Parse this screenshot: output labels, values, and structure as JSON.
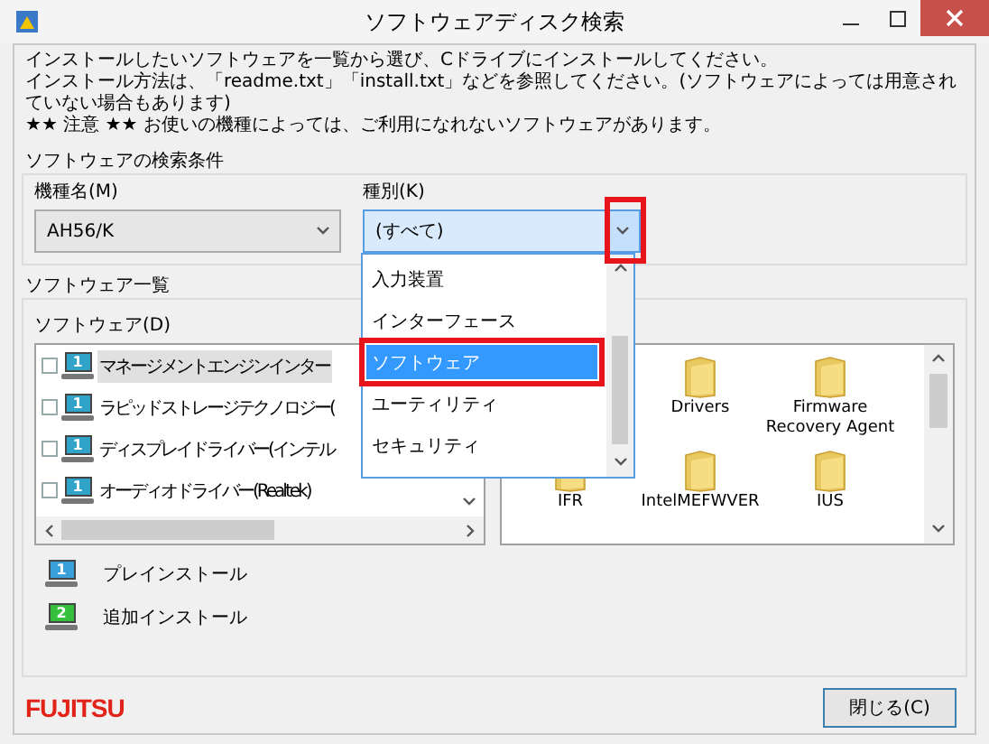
{
  "window": {
    "title": "ソフトウェアディスク検索"
  },
  "instructions": [
    "インストールしたいソフトウェアを一覧から選び、Cドライブにインストールしてください。",
    "インストール方法は、「readme.txt」「install.txt」などを参照してください。(ソフトウェアによっては用意されていない場合もあります)",
    "★★ 注意 ★★ お使いの機種によっては、ご利用になれないソフトウェアがあります。"
  ],
  "search_conditions": {
    "title": "ソフトウェアの検索条件",
    "model": {
      "label": "機種名(M)",
      "value": "AH56/K"
    },
    "category": {
      "label": "種別(K)",
      "value": "(すべて)",
      "expanded": true,
      "options": [
        {
          "label": "入力装置",
          "selected": false
        },
        {
          "label": "インターフェース",
          "selected": false
        },
        {
          "label": "ソフトウェア",
          "selected": true
        },
        {
          "label": "ユーティリティ",
          "selected": false
        },
        {
          "label": "セキュリティ",
          "selected": false
        }
      ]
    }
  },
  "software_list": {
    "title": "ソフトウェア一覧",
    "tree_label": "ソフトウェア(D)",
    "tree": [
      {
        "label": "マネージメントエンジンインター",
        "badge": "1",
        "selected": true
      },
      {
        "label": "ラピッドストレージテクノロジー(",
        "badge": "1",
        "selected": false
      },
      {
        "label": "ディスプレイドライバー(インテル",
        "badge": "1",
        "selected": false
      },
      {
        "label": "オーディオドライバー(Realtek)",
        "badge": "1",
        "selected": false
      }
    ],
    "folders": [
      {
        "label": "Drivers"
      },
      {
        "label": "Firmware Recovery Agent"
      },
      {
        "label": "IFR"
      },
      {
        "label": "IntelMEFWVER"
      },
      {
        "label": "IUS"
      }
    ]
  },
  "legend": [
    {
      "badge": "1",
      "label": "プレインストール",
      "color": "#3aa0dc"
    },
    {
      "badge": "2",
      "label": "追加インストール",
      "color": "#34c03c"
    }
  ],
  "logo": "FUJITSU",
  "close_button": "閉じる(C)"
}
